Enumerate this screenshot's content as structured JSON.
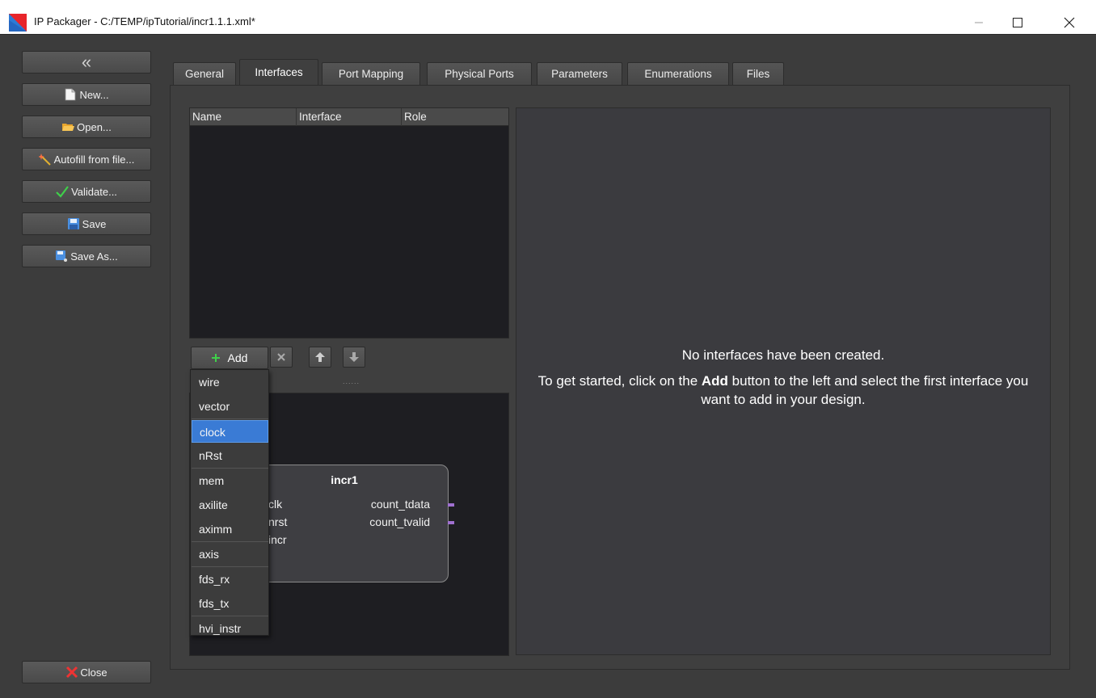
{
  "window": {
    "title": "IP Packager - C:/TEMP/ipTutorial/incr1.1.1.xml*",
    "controls": {
      "minimize": "minimize",
      "maximize": "maximize",
      "close": "close"
    }
  },
  "sidebar": {
    "collapse_label": "«",
    "buttons": [
      {
        "label": "New...",
        "icon": "document-icon"
      },
      {
        "label": "Open...",
        "icon": "folder-icon"
      },
      {
        "label": "Autofill from file...",
        "icon": "magic-wand-icon"
      },
      {
        "label": "Validate...",
        "icon": "checkmark-icon"
      },
      {
        "label": "Save",
        "icon": "floppy-icon"
      },
      {
        "label": "Save As...",
        "icon": "floppy-as-icon"
      }
    ],
    "close_label": "Close"
  },
  "tabs": [
    {
      "label": "General"
    },
    {
      "label": "Interfaces"
    },
    {
      "label": "Port Mapping"
    },
    {
      "label": "Physical Ports"
    },
    {
      "label": "Parameters"
    },
    {
      "label": "Enumerations"
    },
    {
      "label": "Files"
    }
  ],
  "active_tab": "Interfaces",
  "interface_table": {
    "columns": [
      "Name",
      "Interface",
      "Role"
    ],
    "rows": []
  },
  "toolbar": {
    "add_label": "Add",
    "remove_icon": "x-icon",
    "move_up_icon": "arrow-up-icon",
    "move_down_icon": "arrow-down-icon",
    "splitter": "......"
  },
  "add_menu": {
    "items": [
      "wire",
      "vector",
      "clock",
      "nRst",
      "mem",
      "axilite",
      "aximm",
      "axis",
      "fds_rx",
      "fds_tx",
      "hvi_instr"
    ],
    "selected": "clock"
  },
  "diagram": {
    "block_name": "incr1",
    "inputs": [
      "clk",
      "nrst",
      "incr"
    ],
    "outputs": [
      "count_tdata",
      "count_tvalid"
    ],
    "port_color": "#a070d0"
  },
  "message": {
    "title": "No interfaces have been created.",
    "body_pre": "To get started, click on the ",
    "body_bold": "Add",
    "body_post": " button to the left and select the first interface you want to add in your design."
  },
  "colors": {
    "background": "#3c3c3c",
    "panel_dark": "#1e1e22",
    "selection": "#3a7bd5"
  }
}
